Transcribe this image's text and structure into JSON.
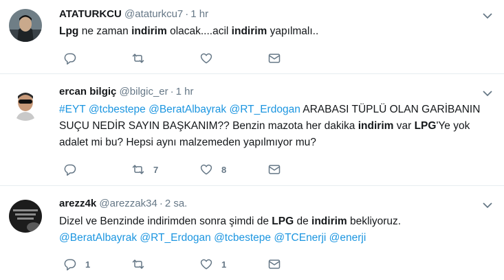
{
  "tweets": [
    {
      "name": "ATATURKCU",
      "handle": "@ataturkcu7",
      "time": "1 hr",
      "segments": [
        {
          "t": "Lpg",
          "s": "b"
        },
        {
          "t": " ne zaman ",
          "s": "n"
        },
        {
          "t": "indirim",
          "s": "b"
        },
        {
          "t": " olacak....acil ",
          "s": "n"
        },
        {
          "t": "indirim",
          "s": "b"
        },
        {
          "t": " yapılmalı..",
          "s": "n"
        }
      ],
      "reply_count": "",
      "retweet_count": "",
      "like_count": ""
    },
    {
      "name": "ercan bilgiç",
      "handle": "@bilgic_er",
      "time": "1 hr",
      "segments": [
        {
          "t": "#EYT",
          "s": "l"
        },
        {
          "t": " ",
          "s": "n"
        },
        {
          "t": "@tcbestepe",
          "s": "l"
        },
        {
          "t": " ",
          "s": "n"
        },
        {
          "t": "@BeratAlbayrak",
          "s": "l"
        },
        {
          "t": " ",
          "s": "n"
        },
        {
          "t": "@RT_Erdogan",
          "s": "l"
        },
        {
          "t": " ARABASI TÜPLÜ OLAN GARİBANIN SUÇU NEDİR SAYIN BAŞKANIM?? Benzin mazota her dakika ",
          "s": "n"
        },
        {
          "t": "indirim",
          "s": "b"
        },
        {
          "t": " var ",
          "s": "n"
        },
        {
          "t": "LPG",
          "s": "b"
        },
        {
          "t": "'Ye yok adalet mi bu? Hepsi aynı malzemeden yapılmıyor mu?",
          "s": "n"
        }
      ],
      "reply_count": "",
      "retweet_count": "7",
      "like_count": "8"
    },
    {
      "name": "arezz4k",
      "handle": "@arezzak34",
      "time": "2 sa.",
      "segments": [
        {
          "t": "Dizel ve Benzinde indirimden sonra şimdi de ",
          "s": "n"
        },
        {
          "t": "LPG",
          "s": "b"
        },
        {
          "t": " de ",
          "s": "n"
        },
        {
          "t": "indirim",
          "s": "b"
        },
        {
          "t": " bekliyoruz.",
          "s": "n"
        },
        {
          "t": "\n",
          "s": "br"
        },
        {
          "t": "@BeratAlbayrak",
          "s": "l"
        },
        {
          "t": " ",
          "s": "n"
        },
        {
          "t": "@RT_Erdogan",
          "s": "l"
        },
        {
          "t": " ",
          "s": "n"
        },
        {
          "t": "@tcbestepe",
          "s": "l"
        },
        {
          "t": " ",
          "s": "n"
        },
        {
          "t": "@TCEnerji",
          "s": "l"
        },
        {
          "t": " ",
          "s": "n"
        },
        {
          "t": "@enerji",
          "s": "l"
        }
      ],
      "reply_count": "1",
      "retweet_count": "",
      "like_count": "1"
    }
  ],
  "icons": {
    "reply": "reply-icon",
    "retweet": "retweet-icon",
    "like": "heart-icon",
    "message": "envelope-icon",
    "more": "chevron-down-icon"
  },
  "colors": {
    "link": "#1b95e0",
    "muted": "#657786",
    "text": "#14171a",
    "divider": "#e6ecf0"
  }
}
